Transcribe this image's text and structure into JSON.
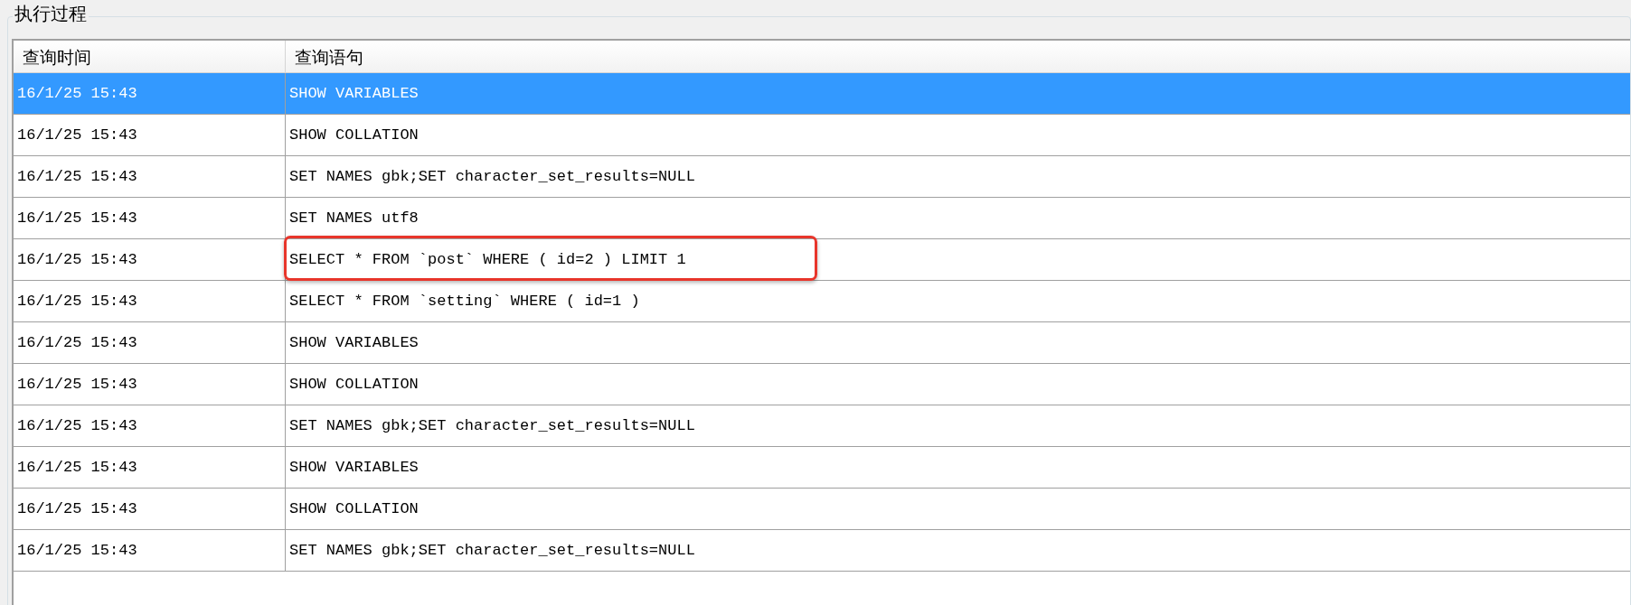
{
  "group_title": "执行过程",
  "table": {
    "columns": [
      "查询时间",
      "查询语句"
    ],
    "rows": [
      {
        "time": "16/1/25 15:43",
        "query": "SHOW VARIABLES",
        "selected": true,
        "highlighted": false
      },
      {
        "time": "16/1/25 15:43",
        "query": "SHOW COLLATION",
        "selected": false,
        "highlighted": false
      },
      {
        "time": "16/1/25 15:43",
        "query": "SET NAMES gbk;SET character_set_results=NULL",
        "selected": false,
        "highlighted": false
      },
      {
        "time": "16/1/25 15:43",
        "query": "SET NAMES utf8",
        "selected": false,
        "highlighted": false
      },
      {
        "time": "16/1/25 15:43",
        "query": "SELECT * FROM `post` WHERE ( id=2 ) LIMIT 1",
        "selected": false,
        "highlighted": true
      },
      {
        "time": "16/1/25 15:43",
        "query": "SELECT * FROM `setting` WHERE ( id=1 )",
        "selected": false,
        "highlighted": false
      },
      {
        "time": "16/1/25 15:43",
        "query": "SHOW VARIABLES",
        "selected": false,
        "highlighted": false
      },
      {
        "time": "16/1/25 15:43",
        "query": "SHOW COLLATION",
        "selected": false,
        "highlighted": false
      },
      {
        "time": "16/1/25 15:43",
        "query": "SET NAMES gbk;SET character_set_results=NULL",
        "selected": false,
        "highlighted": false
      },
      {
        "time": "16/1/25 15:43",
        "query": "SHOW VARIABLES",
        "selected": false,
        "highlighted": false
      },
      {
        "time": "16/1/25 15:43",
        "query": "SHOW COLLATION",
        "selected": false,
        "highlighted": false
      },
      {
        "time": "16/1/25 15:43",
        "query": "SET NAMES gbk;SET character_set_results=NULL",
        "selected": false,
        "highlighted": false
      }
    ]
  }
}
